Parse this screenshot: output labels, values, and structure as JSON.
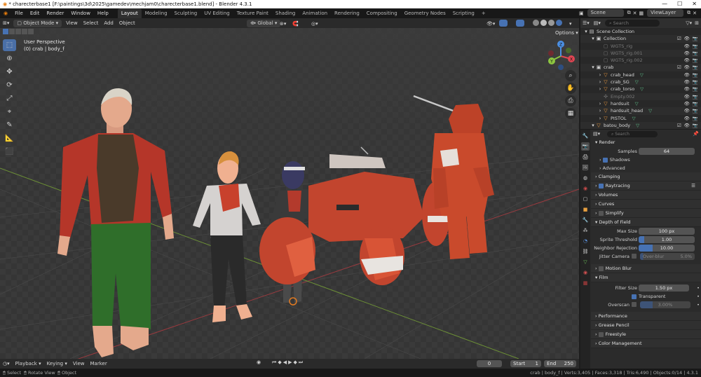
{
  "window": {
    "title": "* charecterbase1 [F:\\paintings\\3d\\2025\\gamedev\\mechjam0\\charecterbase1.blend] - Blender 4.3.1",
    "controls": [
      "—",
      "☐",
      "✕"
    ]
  },
  "menu": [
    "File",
    "Edit",
    "Render",
    "Window",
    "Help"
  ],
  "workspaces": [
    "Layout",
    "Modeling",
    "Sculpting",
    "UV Editing",
    "Texture Paint",
    "Shading",
    "Animation",
    "Rendering",
    "Compositing",
    "Geometry Nodes",
    "Scripting"
  ],
  "active_workspace": "Layout",
  "topbar": {
    "add_ws": "+",
    "scene": "Scene",
    "view_layer": "ViewLayer"
  },
  "viewport_header": {
    "mode": "Object Mode",
    "menus": [
      "View",
      "Select",
      "Add",
      "Object"
    ],
    "transform_orientation": "Global",
    "options": "Options"
  },
  "viewport_overlay": {
    "view_name": "User Perspective",
    "object_info": "(0) crab | body_f"
  },
  "gizmo": {
    "x": "X",
    "y": "Y",
    "z": "Z"
  },
  "timeline": {
    "menus": [
      "Playback",
      "Keying",
      "View",
      "Marker"
    ],
    "current_frame": "0",
    "start_label": "Start",
    "start": "1",
    "end_label": "End",
    "end": "250"
  },
  "statusbar": {
    "left": [
      "Select",
      "Rotate View",
      "Object"
    ],
    "right": "crab | body_f | Verts:3,405 | Faces:3,318 | Tris:6,490 | Objects:0/14 | 4.3.1"
  },
  "outliner": {
    "search_placeholder": "Search",
    "rows": [
      {
        "label": "Scene Collection",
        "icon": "scene-collection-icon",
        "glyph": "▤",
        "depth": 0,
        "dim": false
      },
      {
        "label": "Collection",
        "icon": "collection-icon",
        "glyph": "▣",
        "depth": 1,
        "dim": false
      },
      {
        "label": "WGTS_rig",
        "icon": "collection-icon",
        "glyph": "▢",
        "depth": 2,
        "dim": true
      },
      {
        "label": "WGTS_rig.001",
        "icon": "collection-icon",
        "glyph": "▢",
        "depth": 2,
        "dim": true
      },
      {
        "label": "WGTS_rig.002",
        "icon": "collection-icon",
        "glyph": "▢",
        "depth": 2,
        "dim": true
      },
      {
        "label": "crab",
        "icon": "collection-icon",
        "glyph": "▣",
        "depth": 1,
        "dim": false
      },
      {
        "label": "crab_head",
        "icon": "mesh-icon",
        "glyph": "▽",
        "depth": 2,
        "dim": false
      },
      {
        "label": "crab_SG",
        "icon": "mesh-icon",
        "glyph": "▽",
        "depth": 2,
        "dim": false
      },
      {
        "label": "crab_torso",
        "icon": "mesh-icon",
        "glyph": "▽",
        "depth": 2,
        "dim": false
      },
      {
        "label": "Empty.002",
        "icon": "empty-icon",
        "glyph": "✣",
        "depth": 2,
        "dim": true
      },
      {
        "label": "hardsuit",
        "icon": "mesh-icon",
        "glyph": "▽",
        "depth": 2,
        "dim": false
      },
      {
        "label": "hardsuit_head",
        "icon": "mesh-icon",
        "glyph": "▽",
        "depth": 2,
        "dim": false
      },
      {
        "label": "PISTOL",
        "icon": "mesh-icon",
        "glyph": "▽",
        "depth": 2,
        "dim": false
      },
      {
        "label": "batou_body",
        "icon": "mesh-icon",
        "glyph": "▽",
        "depth": 1,
        "dim": false
      }
    ]
  },
  "properties": {
    "search_placeholder": "Search",
    "render": {
      "title": "Render",
      "samples_label": "Samples",
      "samples": "64",
      "shadows": "Shadows",
      "advanced": "Advanced"
    },
    "panels_a": [
      "Clamping",
      "Raytracing",
      "Volumes",
      "Curves",
      "Simplify"
    ],
    "dof": {
      "title": "Depth of Field",
      "max_size_label": "Max Size",
      "max_size": "100 px",
      "sprite_label": "Sprite Threshold",
      "sprite": "1.00",
      "neighbor_label": "Neighbor Rejection",
      "neighbor": "10.00",
      "jitter_label": "Jitter Camera",
      "overblur_label": "Over-blur",
      "overblur": "5.0%"
    },
    "motion_blur": "Motion Blur",
    "film": {
      "title": "Film",
      "filter_label": "Filter Size",
      "filter": "1.50 px",
      "transparent": "Transparent",
      "overscan_label": "Overscan",
      "overscan": "3.00%"
    },
    "panels_b": [
      "Performance",
      "Grease Pencil",
      "Freestyle",
      "Color Management"
    ]
  },
  "colors": {
    "accent": "#4772b3",
    "x_axis": "#e04552",
    "y_axis": "#8dc641",
    "z_axis": "#4b8fe3",
    "header": "#2a2a2a",
    "panel": "#2b2b2b"
  }
}
